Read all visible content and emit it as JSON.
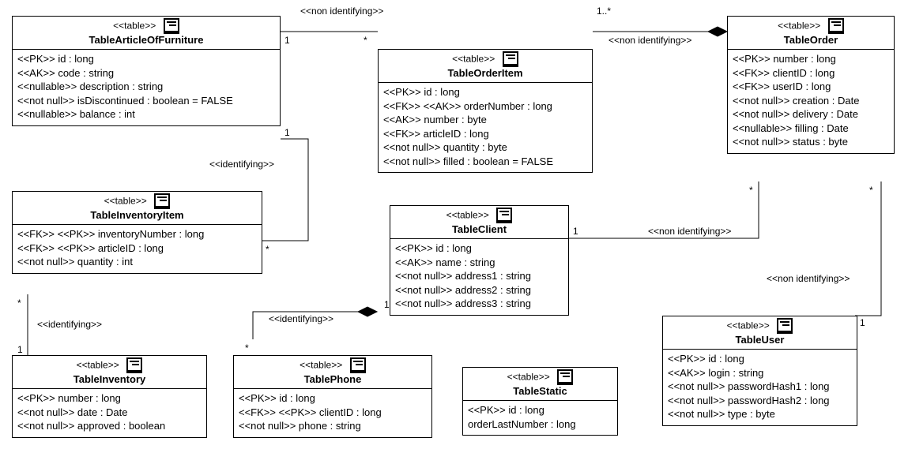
{
  "stereo": "<<table>>",
  "relLabels": {
    "nonIdent": "<<non identifying>>",
    "ident": "<<identifying>>"
  },
  "mult": {
    "one": "1",
    "star": "*",
    "onePlus": "1..*"
  },
  "tables": {
    "article": {
      "name": "TableArticleOfFurniture",
      "attrs": [
        "<<PK>> id : long",
        "<<AK>> code : string",
        "<<nullable>> description : string",
        "<<not null>> isDiscontinued : boolean = FALSE",
        "<<nullable>> balance : int"
      ]
    },
    "orderItem": {
      "name": "TableOrderItem",
      "attrs": [
        "<<PK>> id : long",
        "<<FK>> <<AK>> orderNumber : long",
        "<<AK>> number : byte",
        "<<FK>> articleID : long",
        "<<not null>> quantity : byte",
        "<<not null>> filled : boolean = FALSE"
      ]
    },
    "order": {
      "name": "TableOrder",
      "attrs": [
        "<<PK>> number : long",
        "<<FK>> clientID : long",
        "<<FK>> userID : long",
        "<<not null>> creation : Date",
        "<<not null>> delivery : Date",
        "<<nullable>> filling : Date",
        "<<not null>> status : byte"
      ]
    },
    "inventoryItem": {
      "name": "TableInventoryItem",
      "attrs": [
        "<<FK>> <<PK>> inventoryNumber : long",
        "<<FK>> <<PK>> articleID : long",
        "<<not null>> quantity : int"
      ]
    },
    "client": {
      "name": "TableClient",
      "attrs": [
        "<<PK>> id : long",
        "<<AK>> name : string",
        "<<not null>> address1 : string",
        "<<not null>> address2 : string",
        "<<not null>> address3 : string"
      ]
    },
    "user": {
      "name": "TableUser",
      "attrs": [
        "<<PK>> id : long",
        "<<AK>> login : string",
        "<<not null>> passwordHash1 : long",
        "<<not null>> passwordHash2 : long",
        "<<not null>> type : byte"
      ]
    },
    "inventory": {
      "name": "TableInventory",
      "attrs": [
        "<<PK>> number : long",
        "<<not null>> date : Date",
        "<<not null>> approved : boolean"
      ]
    },
    "phone": {
      "name": "TablePhone",
      "attrs": [
        "<<PK>> id : long",
        "<<FK>> <<PK>> clientID : long",
        "<<not null>> phone : string"
      ]
    },
    "static": {
      "name": "TableStatic",
      "attrs": [
        "<<PK>> id : long",
        "orderLastNumber : long"
      ]
    }
  }
}
